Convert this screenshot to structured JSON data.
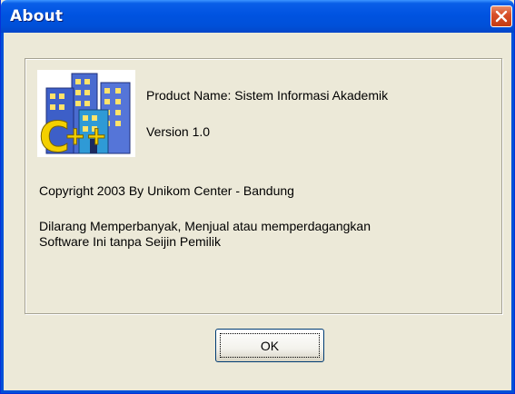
{
  "window": {
    "title": "About"
  },
  "icon": "cpp-buildings-icon",
  "info": {
    "product_name": "Product Name: Sistem Informasi Akademik",
    "version": "Version 1.0",
    "copyright": "Copyright 2003 By  Unikom Center - Bandung",
    "warning_line1": "Dilarang Memperbanyak, Menjual atau memperdagangkan",
    "warning_line2": "Software Ini tanpa Seijin Pemilik"
  },
  "buttons": {
    "ok_label": "OK"
  },
  "colors": {
    "titlebar": "#0053e1",
    "dialog_bg": "#ece9d8",
    "close_button": "#d8502a"
  }
}
